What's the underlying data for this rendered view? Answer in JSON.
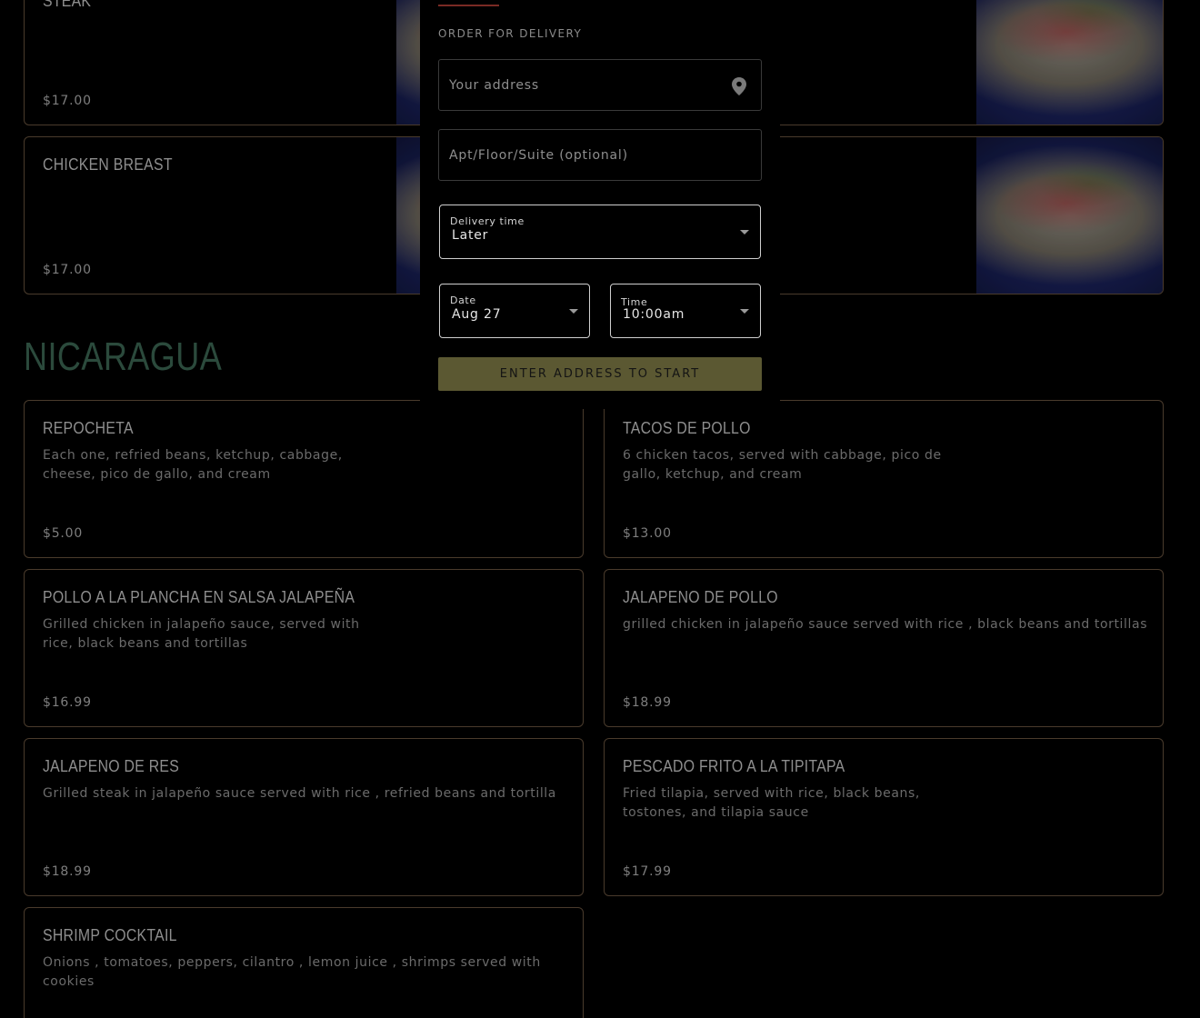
{
  "colors": {
    "background": "#000000",
    "card_border": "#4a3b2c",
    "section_title": "#2b4a3c",
    "button_bg": "#5b5832",
    "tab_indicator": "#7a2a24"
  },
  "top_row": [
    {
      "name": "Steak",
      "price": "$17.00"
    },
    {
      "name": "",
      "price": ""
    }
  ],
  "second_row": [
    {
      "name": "Chicken Breast",
      "price": "$17.00"
    },
    {
      "name": "",
      "price": ""
    }
  ],
  "section": {
    "title": "NICARAGUA"
  },
  "items": [
    {
      "name": "Repocheta",
      "desc": "Each one, refried beans, ketchup, cabbage, cheese, pico de gallo, and cream",
      "price": "$5.00"
    },
    {
      "name": "Tacos de pollo",
      "desc": "6 chicken tacos, served with cabbage, pico de gallo, ketchup, and cream",
      "price": "$13.00"
    },
    {
      "name": "Pollo a la plancha en salsa jalapeña",
      "desc": "Grilled chicken in jalapeño sauce, served with rice, black beans and tortillas",
      "price": "$16.99"
    },
    {
      "name": "Jalapeno de pollo",
      "desc": "grilled chicken in jalapeño sauce served with rice , black beans and tortillas",
      "price": "$18.99"
    },
    {
      "name": "Jalapeno de res",
      "desc": "Grilled steak in jalapeño sauce served with rice , refried beans and tortilla",
      "price": "$18.99"
    },
    {
      "name": "Pescado frito a la tipitapa",
      "desc": "Fried tilapia, served with rice, black beans, tostones, and tilapia sauce",
      "price": "$17.99"
    },
    {
      "name": "Shrimp cocktail",
      "desc": "Onions , tomatoes, peppers, cilantro , lemon juice , shrimps served with cookies",
      "price": ""
    }
  ],
  "modal": {
    "heading": "ORDER FOR DELIVERY",
    "address_placeholder": "Your address",
    "apt_placeholder": "Apt/Floor/Suite (optional)",
    "delivery_time": {
      "label": "Delivery time",
      "value": "Later"
    },
    "date": {
      "label": "Date",
      "value": "Aug 27"
    },
    "time": {
      "label": "Time",
      "value": "10:00am"
    },
    "cta": "ENTER ADDRESS TO START"
  }
}
